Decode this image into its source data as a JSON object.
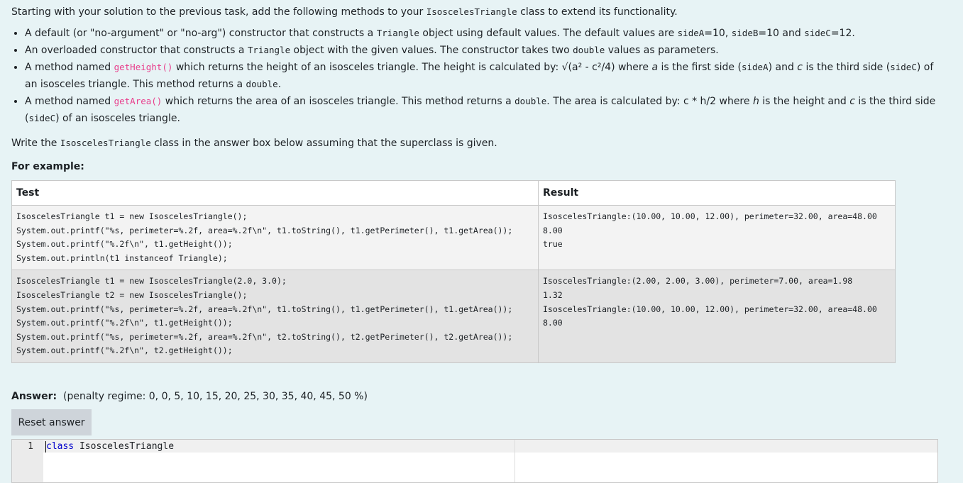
{
  "intro": {
    "prefix": "Starting with your solution to the previous task, add the following methods to your ",
    "classname": "IsoscelesTriangle",
    "suffix": " class to extend its functionality."
  },
  "requirements": [
    {
      "p1": "A default (or \"no-argument\" or \"no-arg\") constructor that constructs a ",
      "m1": "Triangle",
      "p2": " object using default values. The default values are ",
      "m2": "sideA",
      "p3": "=10, ",
      "m3": "sideB",
      "p4": "=10 and ",
      "m4": "sideC",
      "p5": "=12."
    },
    {
      "p1": "An overloaded constructor that constructs a ",
      "m1": "Triangle",
      "p2": " object with the given values. The constructor takes two ",
      "m2": "double",
      "p3": " values as parameters."
    },
    {
      "p1": "A method named ",
      "c1": "getHeight()",
      "p2": " which returns the height of an isosceles triangle. The height is calculated by: √(a² - c²/4) where ",
      "e1": "a",
      "p3": " is the first side (",
      "m1": "sideA",
      "p4": ") and ",
      "e2": "c",
      "p5": " is the third side (",
      "m2": "sideC",
      "p6": ") of an isosceles triangle. This method returns a ",
      "m3": "double",
      "p7": "."
    },
    {
      "p1": "A method named ",
      "c1": "getArea()",
      "p2": " which returns the area of an isosceles triangle. This method returns a ",
      "m1": "double",
      "p3": ". The area is calculated by: c * h/2 where ",
      "e1": "h",
      "p4": " is the height and ",
      "e2": "c",
      "p5": " is the third side (",
      "m2": "sideC",
      "p6": ") of an isosceles triangle."
    }
  ],
  "write": {
    "p1": "Write the ",
    "m1": "IsoscelesTriangle",
    "p2": " class in the answer box below assuming that the superclass is given."
  },
  "for_example": "For example:",
  "table": {
    "headers": [
      "Test",
      "Result"
    ],
    "rows": [
      {
        "test": "IsoscelesTriangle t1 = new IsoscelesTriangle();\nSystem.out.printf(\"%s, perimeter=%.2f, area=%.2f\\n\", t1.toString(), t1.getPerimeter(), t1.getArea());\nSystem.out.printf(\"%.2f\\n\", t1.getHeight());\nSystem.out.println(t1 instanceof Triangle);",
        "result": "IsoscelesTriangle:(10.00, 10.00, 12.00), perimeter=32.00, area=48.00\n8.00\ntrue"
      },
      {
        "test": "IsoscelesTriangle t1 = new IsoscelesTriangle(2.0, 3.0);\nIsoscelesTriangle t2 = new IsoscelesTriangle();\nSystem.out.printf(\"%s, perimeter=%.2f, area=%.2f\\n\", t1.toString(), t1.getPerimeter(), t1.getArea());\nSystem.out.printf(\"%.2f\\n\", t1.getHeight());\nSystem.out.printf(\"%s, perimeter=%.2f, area=%.2f\\n\", t2.toString(), t2.getPerimeter(), t2.getArea());\nSystem.out.printf(\"%.2f\\n\", t2.getHeight());",
        "result": "IsoscelesTriangle:(2.00, 2.00, 3.00), perimeter=7.00, area=1.98\n1.32\nIsoscelesTriangle:(10.00, 10.00, 12.00), perimeter=32.00, area=48.00\n8.00"
      }
    ]
  },
  "answer": {
    "label": "Answer:",
    "penalty": "(penalty regime: 0, 0, 5, 10, 15, 20, 25, 30, 35, 40, 45, 50 %)",
    "reset_label": "Reset answer"
  },
  "editor": {
    "line_number": "1",
    "keyword": "class",
    "code_rest": " IsoscelesTriangle"
  }
}
